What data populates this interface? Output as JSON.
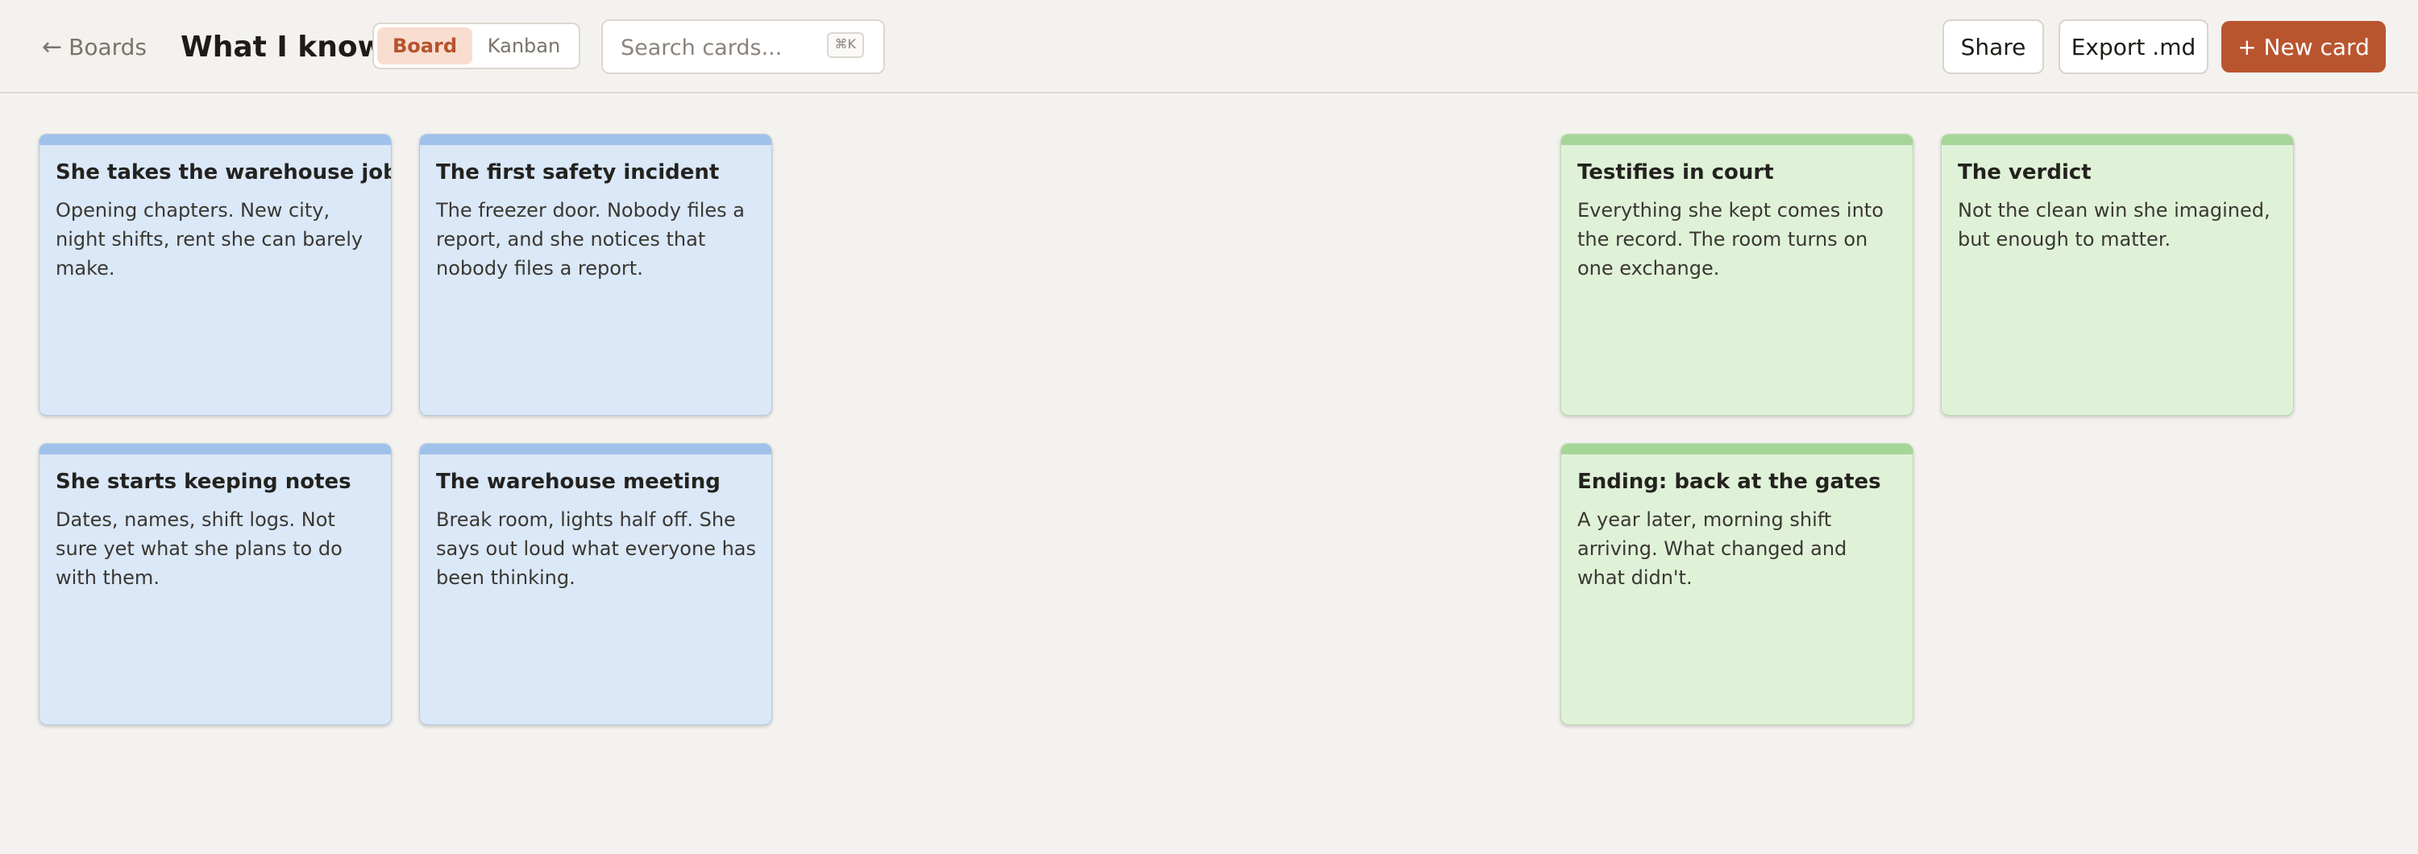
{
  "header": {
    "back_label": "Boards",
    "back_icon": "←",
    "title": "What I know",
    "view_toggle": {
      "board": "Board",
      "kanban": "Kanban",
      "selected": "Board"
    },
    "search": {
      "placeholder": "Search cards...",
      "value": "",
      "shortcut": "⌘K"
    },
    "share_label": "Share",
    "export_label": "Export .md",
    "new_card_label": "+ New card"
  },
  "colors": {
    "accent": "#b9552e",
    "blue_card": "#dae8f8",
    "blue_strip": "#a0c1ea",
    "green_card": "#dff2d8",
    "green_strip": "#a6d598"
  },
  "cards": [
    {
      "title": "She takes the warehouse job",
      "description": "Opening chapters. New city, night shifts, rent she can barely make.",
      "color": "blue"
    },
    {
      "title": "The first safety incident",
      "description": "The freezer door. Nobody files a report, and she notices that nobody files a report.",
      "color": "blue"
    },
    {
      "title": "Testifies in court",
      "description": "Everything she kept comes into the record. The room turns on one exchange.",
      "color": "green"
    },
    {
      "title": "The verdict",
      "description": "Not the clean win she imagined, but enough to matter.",
      "color": "green"
    },
    {
      "title": "She starts keeping notes",
      "description": "Dates, names, shift logs. Not sure yet what she plans to do with them.",
      "color": "blue"
    },
    {
      "title": "The warehouse meeting",
      "description": "Break room, lights half off. She says out loud what everyone has been thinking.",
      "color": "blue"
    },
    {
      "title": "Ending: back at the gates",
      "description": "A year later, morning shift arriving. What changed and what didn't.",
      "color": "green"
    }
  ]
}
